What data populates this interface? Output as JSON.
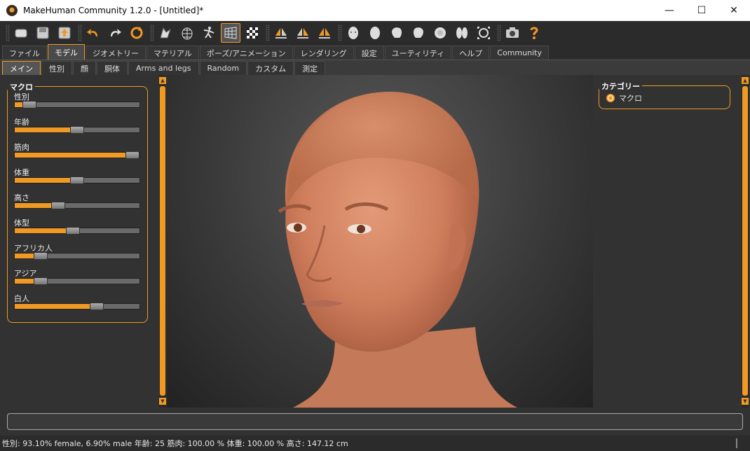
{
  "window": {
    "title": "MakeHuman Community 1.2.0 - [Untitled]*",
    "controls": [
      "—",
      "☐",
      "✕"
    ]
  },
  "toolbar": {
    "icons": [
      "undo-icon",
      "redo-icon",
      "reset-icon"
    ]
  },
  "main_tabs": [
    {
      "label": "ファイル",
      "active": false
    },
    {
      "label": "モデル",
      "active": true
    },
    {
      "label": "ジオメトリー",
      "active": false
    },
    {
      "label": "マテリアル",
      "active": false
    },
    {
      "label": "ポーズ/アニメーション",
      "active": false
    },
    {
      "label": "レンダリング",
      "active": false
    },
    {
      "label": "設定",
      "active": false
    },
    {
      "label": "ユーティリティ",
      "active": false
    },
    {
      "label": "ヘルプ",
      "active": false
    },
    {
      "label": "Community",
      "active": false
    }
  ],
  "sub_tabs": [
    {
      "label": "メイン",
      "active": true
    },
    {
      "label": "性別",
      "active": false
    },
    {
      "label": "顔",
      "active": false
    },
    {
      "label": "胴体",
      "active": false
    },
    {
      "label": "Arms and legs",
      "active": false
    },
    {
      "label": "Random",
      "active": false
    },
    {
      "label": "カスタム",
      "active": false
    },
    {
      "label": "測定",
      "active": false
    }
  ],
  "macro_panel": {
    "title": "マクロ",
    "sliders": [
      {
        "label": "性別",
        "value": 0.07
      },
      {
        "label": "年齢",
        "value": 0.5
      },
      {
        "label": "筋肉",
        "value": 1.0
      },
      {
        "label": "体重",
        "value": 0.5
      },
      {
        "label": "高さ",
        "value": 0.33
      },
      {
        "label": "体型",
        "value": 0.46
      },
      {
        "label": "アフリカ人",
        "value": 0.17
      },
      {
        "label": "アジア",
        "value": 0.17
      },
      {
        "label": "白人",
        "value": 0.68
      }
    ]
  },
  "category_panel": {
    "title": "カテゴリー",
    "option": "マクロ"
  },
  "status": {
    "text": "性別: 93.10% female, 6.90% male  年齢: 25  筋肉: 100.00 %  体重: 100.00 %  高さ: 147.12 cm"
  }
}
